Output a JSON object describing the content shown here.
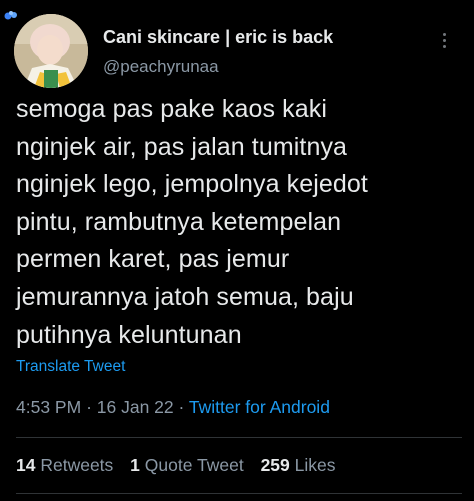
{
  "author": {
    "display_name": "Cani skincare | eric is back",
    "handle": "@peachyrunaa",
    "avatar_icon": "avatar-photo"
  },
  "tweet": {
    "text": "semoga pas pake kaos kaki\nnginjek air, pas jalan tumitnya\nnginjek lego, jempolnya kejedot\npintu, rambutnya ketempelan\npermen karet, pas jemur\njemurannya jatoh semua, baju\nputihnya keluntunan",
    "translate_label": "Translate Tweet"
  },
  "meta": {
    "time": "4:53 PM",
    "separator": "·",
    "date": "16 Jan 22",
    "source": "Twitter for Android"
  },
  "stats": {
    "retweets_count": "14",
    "retweets_label": "Retweets",
    "quote_count": "1",
    "quote_label": "Quote Tweet",
    "likes_count": "259",
    "likes_label": "Likes"
  },
  "colors": {
    "background": "#000000",
    "text": "#e7e9ea",
    "secondary": "#8b98a5",
    "accent": "#1d9bf0",
    "divider": "#2f3336"
  }
}
